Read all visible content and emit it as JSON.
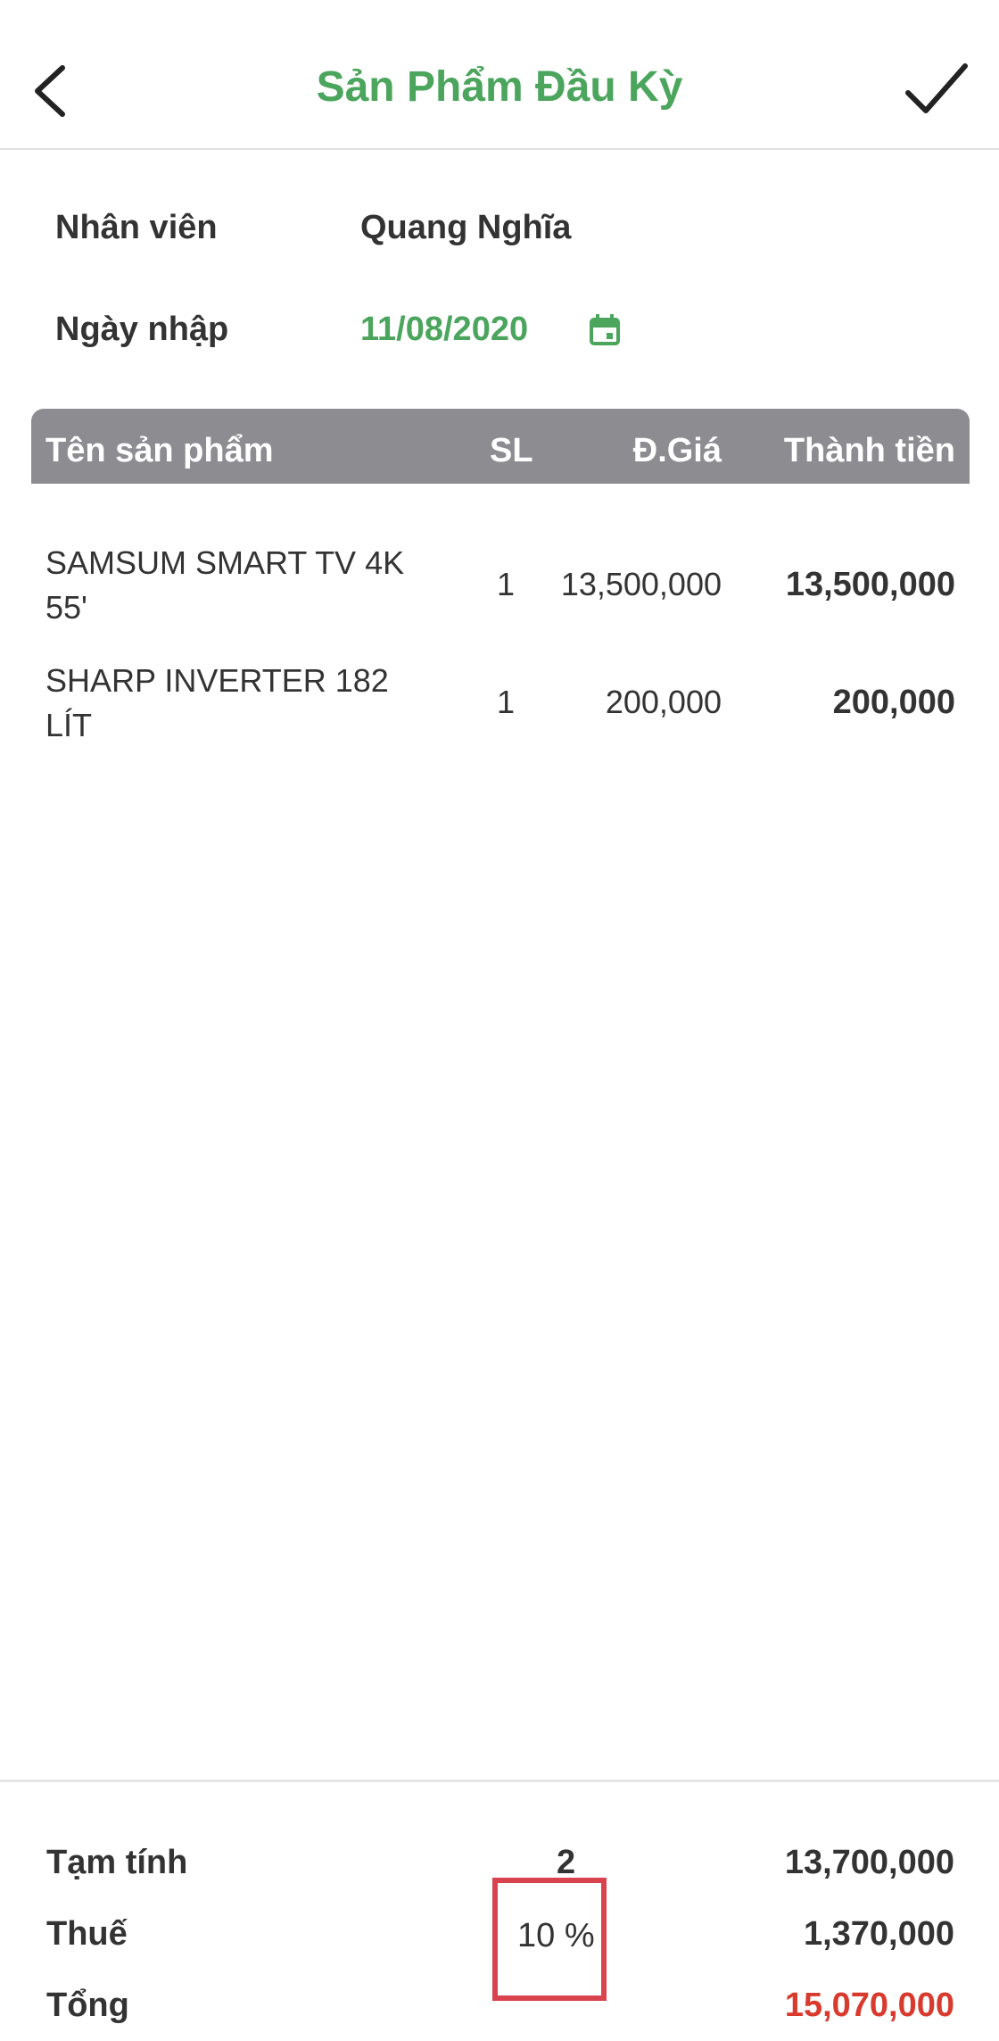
{
  "header": {
    "title": "Sản Phẩm Đầu Kỳ",
    "back_icon": "chevron-left-icon",
    "confirm_icon": "checkmark-icon"
  },
  "info": {
    "employee_label": "Nhân viên",
    "employee_value": "Quang Nghĩa",
    "date_label": "Ngày nhập",
    "date_value": "11/08/2020",
    "date_icon": "calendar-icon"
  },
  "table": {
    "headers": {
      "name": "Tên sản phẩm",
      "qty": "SL",
      "price": "Đ.Giá",
      "total": "Thành tiền"
    },
    "rows": [
      {
        "name": "SAMSUM SMART TV 4K 55'",
        "qty": "1",
        "price": "13,500,000",
        "total": "13,500,000"
      },
      {
        "name": "SHARP INVERTER 182 LÍT",
        "qty": "1",
        "price": "200,000",
        "total": "200,000"
      }
    ]
  },
  "summary": {
    "subtotal_label": "Tạm tính",
    "subtotal_count": "2",
    "subtotal_value": "13,700,000",
    "tax_label": "Thuế",
    "tax_rate": "10 %",
    "tax_value": "1,370,000",
    "total_label": "Tổng",
    "total_value": "15,070,000"
  },
  "colors": {
    "accent": "#4ba55d",
    "header_bg": "#8d8c91",
    "total_red": "#d83a2e",
    "highlight_box": "#d9434e"
  }
}
